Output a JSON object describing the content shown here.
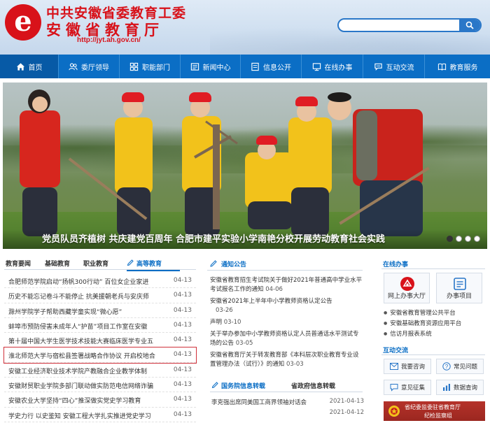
{
  "header": {
    "logo_glyph": "e",
    "title_line1": "中共安徽省委教育工委",
    "title_line2": "安徽省教育厅",
    "url": "http://jyt.ah.gov.cn/",
    "search_placeholder": ""
  },
  "nav": {
    "items": [
      {
        "label": "首页",
        "icon": "home-icon"
      },
      {
        "label": "委厅领导",
        "icon": "people-icon"
      },
      {
        "label": "职能部门",
        "icon": "grid-icon"
      },
      {
        "label": "新闻中心",
        "icon": "news-icon"
      },
      {
        "label": "信息公开",
        "icon": "doc-icon"
      },
      {
        "label": "在线办事",
        "icon": "service-icon"
      },
      {
        "label": "互动交流",
        "icon": "chat-icon"
      },
      {
        "label": "教育服务",
        "icon": "book-icon"
      }
    ]
  },
  "banner": {
    "caption": "党员队员齐植树  共庆建党百周年  合肥市建平实验小学南艳分校开展劳动教育社会实践"
  },
  "news": {
    "tabs": [
      "教育要闻",
      "基础教育",
      "职业教育",
      "高等教育"
    ],
    "items": [
      {
        "title": "合肥师范学院启动“扬帆300行动” 百位女企业家进",
        "date": "04-13"
      },
      {
        "title": "历史不能忘记卷斗不能停止 抗美援朝老兵与安庆师",
        "date": "04-13"
      },
      {
        "title": "滁州学院学子帮助西藏学童实现“微心愿”",
        "date": "04-13"
      },
      {
        "title": "蚌埠市预防侵害未成年人“护苗”项目工作室在安徽",
        "date": "04-13"
      },
      {
        "title": "第十届中国大学生医学技术技能大赛临床医学专业五",
        "date": "04-13"
      },
      {
        "title": "淮北师范大学与宿松县签署战略合作协议 开启校地合",
        "date": "04-13"
      },
      {
        "title": "安徽工业经济职业技术学院产教融合企业教学体制",
        "date": "04-13"
      },
      {
        "title": "安徽财贸职业学院多部门联动做实防范电信网络诈骗",
        "date": "04-13"
      },
      {
        "title": "安徽农业大学坚持“四心”推深做实党史学习教育",
        "date": "04-13"
      },
      {
        "title": "学史力行 以史鉴知 安徽工程大学扎实推进党史学习",
        "date": "04-13"
      }
    ]
  },
  "notices": {
    "title": "通知公告",
    "items": [
      {
        "title": "安徽省教育招生考试院关于做好2021年普通高中学业水平考试报名工作的通知",
        "date": "04-06"
      },
      {
        "title": "安徽省2021年上半年中小学教师资格认定公告",
        "date": "03-26"
      },
      {
        "title": "声明",
        "date": "03-10"
      },
      {
        "title": "关于举办参加中小学教师资格认定人员普通话水平测试专场的公告",
        "date": "03-05"
      },
      {
        "title": "安徽省教育厅关于转发教育部《本科层次职业教育专业设置管理办法（试行）》的通知",
        "date": "03-03"
      }
    ]
  },
  "policy": {
    "tabs": [
      "国务院信息转载",
      "省政府信息转载"
    ],
    "items": [
      {
        "title": "李克强出席同美国工商界领袖对话会",
        "date": "2021-04-13"
      },
      {
        "title": "",
        "date": "2021-04-12"
      }
    ]
  },
  "online": {
    "title": "在线办事",
    "big_buttons": [
      {
        "label": "网上办事大厅",
        "icon": "hall-icon"
      },
      {
        "label": "办事项目",
        "icon": "project-icon"
      }
    ],
    "services": [
      "安徽省教育管理公共平台",
      "安徽基础教育资源应用平台",
      "信访月报表系统"
    ]
  },
  "interact": {
    "title": "互动交流",
    "buttons": [
      {
        "label": "我要咨询",
        "icon": "mail-icon"
      },
      {
        "label": "常见问题",
        "icon": "question-icon"
      },
      {
        "label": "意见征集",
        "icon": "opinion-icon"
      },
      {
        "label": "数据查询",
        "icon": "data-icon"
      }
    ]
  },
  "bottom_banner": {
    "line1": "省纪委监委驻省教育厅",
    "line2": "纪检监察组"
  },
  "colors": {
    "brand_red": "#d8121a",
    "nav_blue": "#0b6ec5",
    "highlight_border": "#d0303a"
  }
}
